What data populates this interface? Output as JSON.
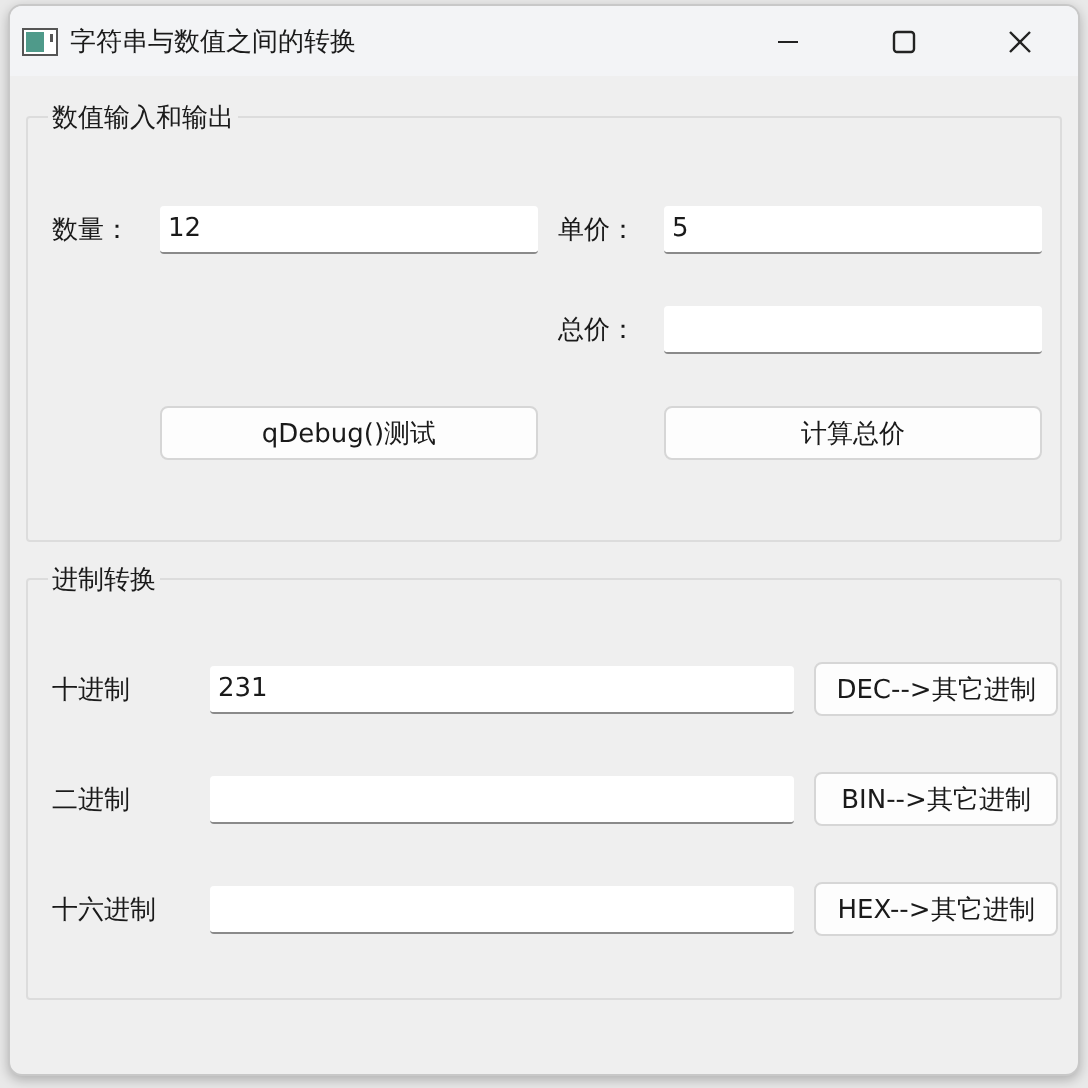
{
  "window": {
    "title": "字符串与数值之间的转换"
  },
  "io_group": {
    "title": "数值输入和输出",
    "fields": [
      {
        "label": "数量：",
        "value": "12"
      },
      {
        "label": "单价：",
        "value": "5"
      },
      {
        "label": "总价："
      }
    ],
    "buttons": [
      "qDebug()测试",
      "计算总价"
    ]
  },
  "conversion_group": {
    "title": "进制转换",
    "rows": [
      {
        "label": "十进制",
        "value": "231",
        "button": "DEC-->其它进制"
      },
      {
        "label": "二进制",
        "button": "BIN-->其它进制"
      },
      {
        "label": "十六进制",
        "button": "HEX-->其它进制"
      }
    ]
  }
}
